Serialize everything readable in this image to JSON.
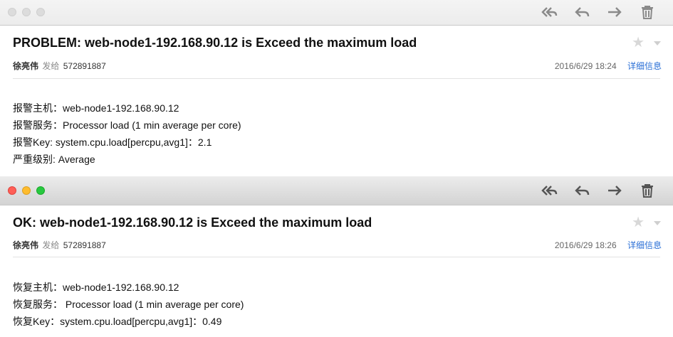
{
  "colors": {
    "red": "#ff5f57",
    "yellow": "#febc2e",
    "green": "#28c840",
    "link": "#2a6fd6"
  },
  "messages": [
    {
      "subject": "PROBLEM: web-node1-192.168.90.12 is Exceed the maximum load",
      "from": "徐亮伟",
      "sent_to": "发给",
      "to": "572891887",
      "date": "2016/6/29",
      "time": "18:24",
      "details": "详细信息",
      "lines": [
        "报警主机：web-node1-192.168.90.12",
        "报警服务：Processor load (1 min average per core)",
        "报警Key: system.cpu.load[percpu,avg1]：2.1",
        "严重级别: Average"
      ]
    },
    {
      "subject": "OK: web-node1-192.168.90.12 is Exceed the maximum load",
      "from": "徐亮伟",
      "sent_to": "发给",
      "to": "572891887",
      "date": "2016/6/29",
      "time": "18:26",
      "details": "详细信息",
      "lines": [
        "恢复主机：web-node1-192.168.90.12",
        "恢复服务： Processor load (1 min average per core)",
        "恢复Key：system.cpu.load[percpu,avg1]：0.49"
      ]
    }
  ],
  "toolbar_icons": [
    "reply-all-icon",
    "reply-icon",
    "forward-icon",
    "trash-icon"
  ]
}
